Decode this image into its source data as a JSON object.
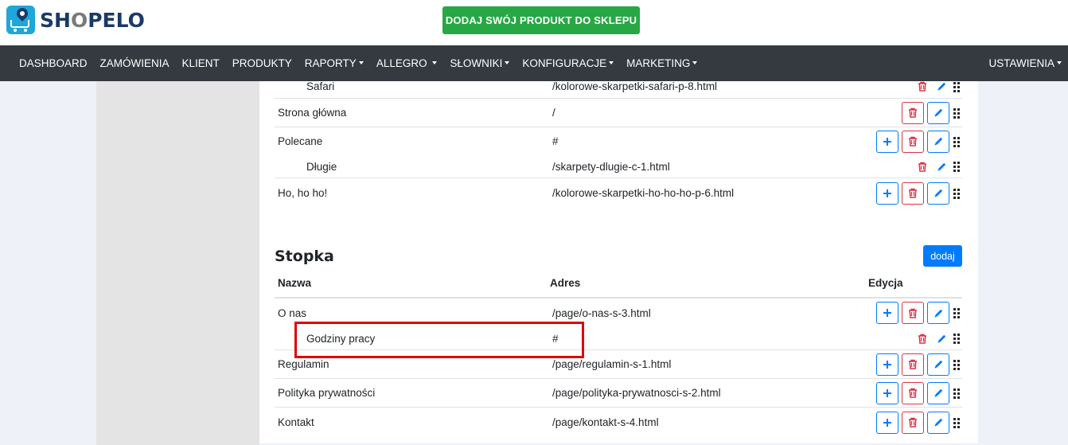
{
  "logo": {
    "text_pre": "SH",
    "text_o": "O",
    "text_post": "PELO"
  },
  "cta": {
    "label": "DODAJ SWÓJ PRODUKT DO SKLEPU"
  },
  "nav": {
    "items": [
      {
        "label": "DASHBOARD",
        "dropdown": false
      },
      {
        "label": "ZAMÓWIENIA",
        "dropdown": false
      },
      {
        "label": "KLIENT",
        "dropdown": false
      },
      {
        "label": "PRODUKTY",
        "dropdown": false
      },
      {
        "label": "RAPORTY",
        "dropdown": true
      },
      {
        "label": "ALLEGRO",
        "dropdown": true
      },
      {
        "label": "SŁOWNIKI",
        "dropdown": true
      },
      {
        "label": "KONFIGURACJE",
        "dropdown": true
      },
      {
        "label": "MARKETING",
        "dropdown": true
      }
    ],
    "right": {
      "label": "USTAWIENIA",
      "dropdown": true
    }
  },
  "top_menu_rows": [
    {
      "name": "Safari",
      "address": "/kolorowe-skarpetki-safari-p-8.html",
      "child": true,
      "buttons": "small"
    },
    {
      "name": "Strona główna",
      "address": "/",
      "child": false,
      "buttons": "del-edit"
    },
    {
      "name": "Polecane",
      "address": "#",
      "child": false,
      "buttons": "add-del-edit"
    },
    {
      "name": "Długie",
      "address": "/skarpety-dlugie-c-1.html",
      "child": true,
      "buttons": "small"
    },
    {
      "name": "Ho, ho ho!",
      "address": "/kolorowe-skarpetki-ho-ho-ho-p-6.html",
      "child": false,
      "buttons": "add-del-edit"
    }
  ],
  "footer_section": {
    "title": "Stopka",
    "add_label": "dodaj",
    "headers": {
      "name": "Nazwa",
      "address": "Adres",
      "edit": "Edycja"
    },
    "rows": [
      {
        "name": "O nas",
        "address": "/page/o-nas-s-3.html",
        "child": false,
        "buttons": "add-del-edit"
      },
      {
        "name": "Godziny pracy",
        "address": "#",
        "child": true,
        "buttons": "small",
        "highlighted": true
      },
      {
        "name": "Regulamin",
        "address": "/page/regulamin-s-1.html",
        "child": false,
        "buttons": "add-del-edit"
      },
      {
        "name": "Polityka prywatności",
        "address": "/page/polityka-prywatnosci-s-2.html",
        "child": false,
        "buttons": "add-del-edit"
      },
      {
        "name": "Kontakt",
        "address": "/page/kontakt-s-4.html",
        "child": false,
        "buttons": "add-del-edit"
      }
    ]
  },
  "colors": {
    "nav_bg": "#343a40",
    "cta": "#28a745",
    "primary": "#007bff",
    "danger": "#dc3545",
    "highlight": "#e00000"
  }
}
